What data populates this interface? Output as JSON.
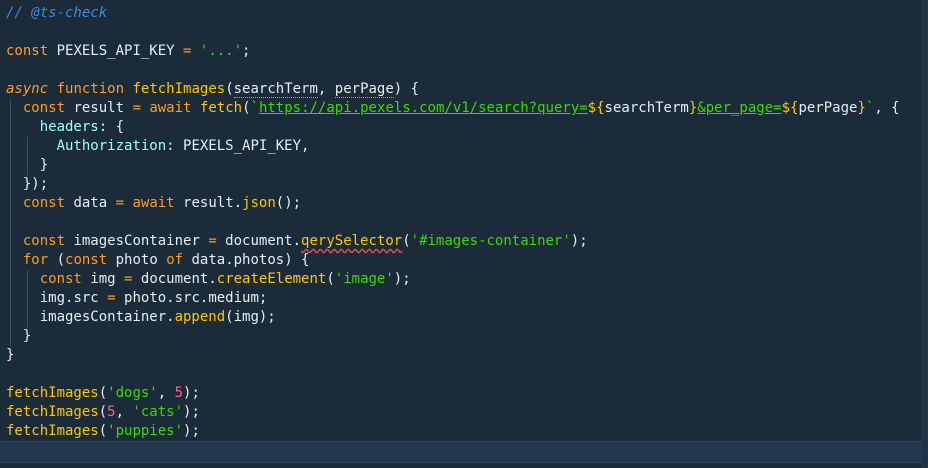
{
  "editor": {
    "lines": [
      {
        "parts": [
          {
            "t": "// @ts-check",
            "c": "cmt"
          }
        ]
      },
      {
        "parts": []
      },
      {
        "parts": [
          {
            "t": "const",
            "c": "kw"
          },
          {
            "t": " PEXELS_API_KEY ",
            "c": "id"
          },
          {
            "t": "=",
            "c": "op"
          },
          {
            "t": " ",
            "c": "id"
          },
          {
            "t": "'...'",
            "c": "str"
          },
          {
            "t": ";",
            "c": "punc"
          }
        ]
      },
      {
        "parts": []
      },
      {
        "parts": [
          {
            "t": "async",
            "c": "kwi"
          },
          {
            "t": " ",
            "c": "id"
          },
          {
            "t": "function",
            "c": "kw"
          },
          {
            "t": " ",
            "c": "id"
          },
          {
            "t": "fetchImages",
            "c": "fn"
          },
          {
            "t": "(",
            "c": "punc"
          },
          {
            "t": "searchTerm",
            "c": "id dotted"
          },
          {
            "t": ", ",
            "c": "punc"
          },
          {
            "t": "perPage",
            "c": "id dotted"
          },
          {
            "t": ") {",
            "c": "punc"
          }
        ]
      },
      {
        "parts": [
          {
            "t": "  ",
            "c": "id"
          },
          {
            "t": "const",
            "c": "kw"
          },
          {
            "t": " result ",
            "c": "id"
          },
          {
            "t": "=",
            "c": "op"
          },
          {
            "t": " ",
            "c": "id"
          },
          {
            "t": "await",
            "c": "kw"
          },
          {
            "t": " ",
            "c": "id"
          },
          {
            "t": "fetch",
            "c": "fn"
          },
          {
            "t": "(",
            "c": "punc"
          },
          {
            "t": "`",
            "c": "str"
          },
          {
            "t": "https://api.pexels.com/v1/search?query=",
            "c": "url"
          },
          {
            "t": "${",
            "c": "interp"
          },
          {
            "t": "searchTerm",
            "c": "id"
          },
          {
            "t": "}",
            "c": "interp"
          },
          {
            "t": "&per_page=",
            "c": "url"
          },
          {
            "t": "${",
            "c": "interp"
          },
          {
            "t": "perPage",
            "c": "id"
          },
          {
            "t": "}",
            "c": "interp"
          },
          {
            "t": "`",
            "c": "str"
          },
          {
            "t": ", {",
            "c": "punc"
          }
        ]
      },
      {
        "parts": [
          {
            "t": "    ",
            "c": "id"
          },
          {
            "t": "headers",
            "c": "prop"
          },
          {
            "t": ": {",
            "c": "punc"
          }
        ]
      },
      {
        "parts": [
          {
            "t": "      ",
            "c": "id"
          },
          {
            "t": "Authorization",
            "c": "prop"
          },
          {
            "t": ": PEXELS_API_KEY,",
            "c": "id"
          }
        ]
      },
      {
        "parts": [
          {
            "t": "    }",
            "c": "punc"
          }
        ]
      },
      {
        "parts": [
          {
            "t": "  });",
            "c": "punc"
          }
        ]
      },
      {
        "parts": [
          {
            "t": "  ",
            "c": "id"
          },
          {
            "t": "const",
            "c": "kw"
          },
          {
            "t": " data ",
            "c": "id"
          },
          {
            "t": "=",
            "c": "op"
          },
          {
            "t": " ",
            "c": "id"
          },
          {
            "t": "await",
            "c": "kw"
          },
          {
            "t": " result.",
            "c": "id"
          },
          {
            "t": "json",
            "c": "fn"
          },
          {
            "t": "();",
            "c": "punc"
          }
        ]
      },
      {
        "parts": []
      },
      {
        "parts": [
          {
            "t": "  ",
            "c": "id"
          },
          {
            "t": "const",
            "c": "kw"
          },
          {
            "t": " imagesContainer ",
            "c": "id"
          },
          {
            "t": "=",
            "c": "op"
          },
          {
            "t": " document.",
            "c": "id"
          },
          {
            "t": "qerySelector",
            "c": "fn squiggle"
          },
          {
            "t": "(",
            "c": "punc"
          },
          {
            "t": "'#images-container'",
            "c": "str"
          },
          {
            "t": ");",
            "c": "punc"
          }
        ]
      },
      {
        "parts": [
          {
            "t": "  ",
            "c": "id"
          },
          {
            "t": "for",
            "c": "kw"
          },
          {
            "t": " (",
            "c": "punc"
          },
          {
            "t": "const",
            "c": "kw"
          },
          {
            "t": " photo ",
            "c": "id"
          },
          {
            "t": "of",
            "c": "kw"
          },
          {
            "t": " data.photos) {",
            "c": "id"
          }
        ]
      },
      {
        "parts": [
          {
            "t": "    ",
            "c": "id"
          },
          {
            "t": "const",
            "c": "kw"
          },
          {
            "t": " img ",
            "c": "id"
          },
          {
            "t": "=",
            "c": "op"
          },
          {
            "t": " document.",
            "c": "id"
          },
          {
            "t": "createElement",
            "c": "fn"
          },
          {
            "t": "(",
            "c": "punc"
          },
          {
            "t": "'image'",
            "c": "str"
          },
          {
            "t": ");",
            "c": "punc"
          }
        ]
      },
      {
        "parts": [
          {
            "t": "    img.",
            "c": "id"
          },
          {
            "t": "src",
            "c": "id"
          },
          {
            "t": " ",
            "c": "id"
          },
          {
            "t": "=",
            "c": "op"
          },
          {
            "t": " photo.src.medium;",
            "c": "id"
          }
        ]
      },
      {
        "parts": [
          {
            "t": "    imagesContainer.",
            "c": "id"
          },
          {
            "t": "append",
            "c": "fn"
          },
          {
            "t": "(img);",
            "c": "punc"
          }
        ]
      },
      {
        "parts": [
          {
            "t": "  }",
            "c": "punc"
          }
        ]
      },
      {
        "parts": [
          {
            "t": "}",
            "c": "punc"
          }
        ]
      },
      {
        "parts": []
      },
      {
        "parts": [
          {
            "t": "fetchImages",
            "c": "fn"
          },
          {
            "t": "(",
            "c": "punc"
          },
          {
            "t": "'dogs'",
            "c": "str"
          },
          {
            "t": ", ",
            "c": "punc"
          },
          {
            "t": "5",
            "c": "num"
          },
          {
            "t": ");",
            "c": "punc"
          }
        ]
      },
      {
        "parts": [
          {
            "t": "fetchImages",
            "c": "fn"
          },
          {
            "t": "(",
            "c": "punc"
          },
          {
            "t": "5",
            "c": "num"
          },
          {
            "t": ", ",
            "c": "punc"
          },
          {
            "t": "'cats'",
            "c": "str"
          },
          {
            "t": ");",
            "c": "punc"
          }
        ]
      },
      {
        "parts": [
          {
            "t": "fetchImages",
            "c": "fn"
          },
          {
            "t": "(",
            "c": "punc"
          },
          {
            "t": "'puppies'",
            "c": "str"
          },
          {
            "t": ");",
            "c": "punc"
          }
        ]
      },
      {
        "parts": []
      }
    ]
  }
}
